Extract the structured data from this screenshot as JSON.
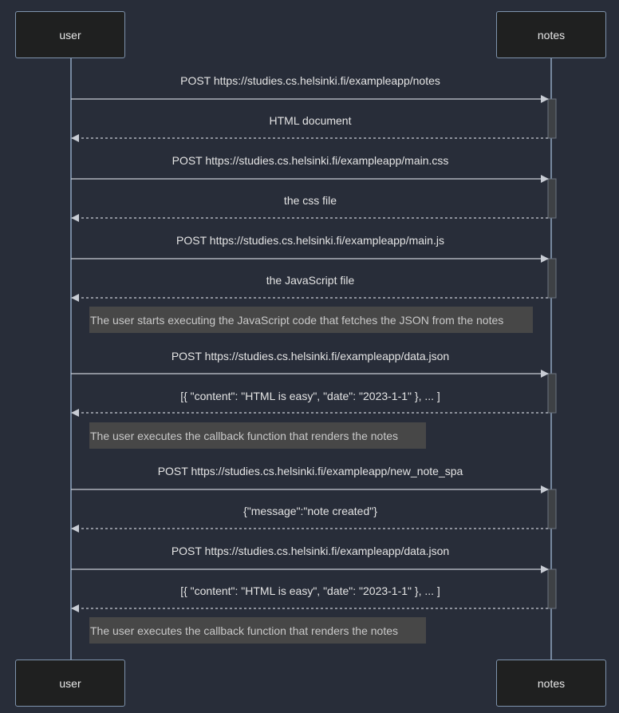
{
  "participants": [
    {
      "id": "user",
      "label": "user"
    },
    {
      "id": "notes",
      "label": "notes"
    }
  ],
  "colors": {
    "background": "#282d39",
    "actor_fill": "#1f2020",
    "actor_border": "#7e93ad",
    "lifeline": "#8fa6c1",
    "arrow": "#c8ccd4",
    "activation_fill": "#3e4145",
    "note_fill": "#474747",
    "text": "#e4e4e4",
    "note_text": "#c9c9c9"
  },
  "messages": [
    {
      "text": "POST https://studies.cs.helsinki.fi/exampleapp/notes",
      "from": "user",
      "to": "notes",
      "style": "solid"
    },
    {
      "text": "HTML document",
      "from": "notes",
      "to": "user",
      "style": "dashed"
    },
    {
      "text": "POST https://studies.cs.helsinki.fi/exampleapp/main.css",
      "from": "user",
      "to": "notes",
      "style": "solid"
    },
    {
      "text": "the css file",
      "from": "notes",
      "to": "user",
      "style": "dashed"
    },
    {
      "text": "POST https://studies.cs.helsinki.fi/exampleapp/main.js",
      "from": "user",
      "to": "notes",
      "style": "solid"
    },
    {
      "text": "the JavaScript file",
      "from": "notes",
      "to": "user",
      "style": "dashed"
    },
    {
      "text": "POST https://studies.cs.helsinki.fi/exampleapp/data.json",
      "from": "user",
      "to": "notes",
      "style": "solid"
    },
    {
      "text": "[{ \"content\": \"HTML is easy\", \"date\": \"2023-1-1\" }, ... ]",
      "from": "notes",
      "to": "user",
      "style": "dashed"
    },
    {
      "text": "POST https://studies.cs.helsinki.fi/exampleapp/new_note_spa",
      "from": "user",
      "to": "notes",
      "style": "solid"
    },
    {
      "text": "{\"message\":\"note created\"}",
      "from": "notes",
      "to": "user",
      "style": "dashed"
    },
    {
      "text": "POST https://studies.cs.helsinki.fi/exampleapp/data.json",
      "from": "user",
      "to": "notes",
      "style": "solid"
    },
    {
      "text": "[{ \"content\": \"HTML is easy\", \"date\": \"2023-1-1\" }, ... ]",
      "from": "notes",
      "to": "user",
      "style": "dashed"
    }
  ],
  "notes": [
    {
      "text": "The user starts executing the JavaScript code that fetches the JSON from the notes",
      "over": "user"
    },
    {
      "text": "The user executes the callback function that renders the notes",
      "over": "user"
    },
    {
      "text": "The user executes the callback function that renders the notes",
      "over": "user"
    }
  ]
}
